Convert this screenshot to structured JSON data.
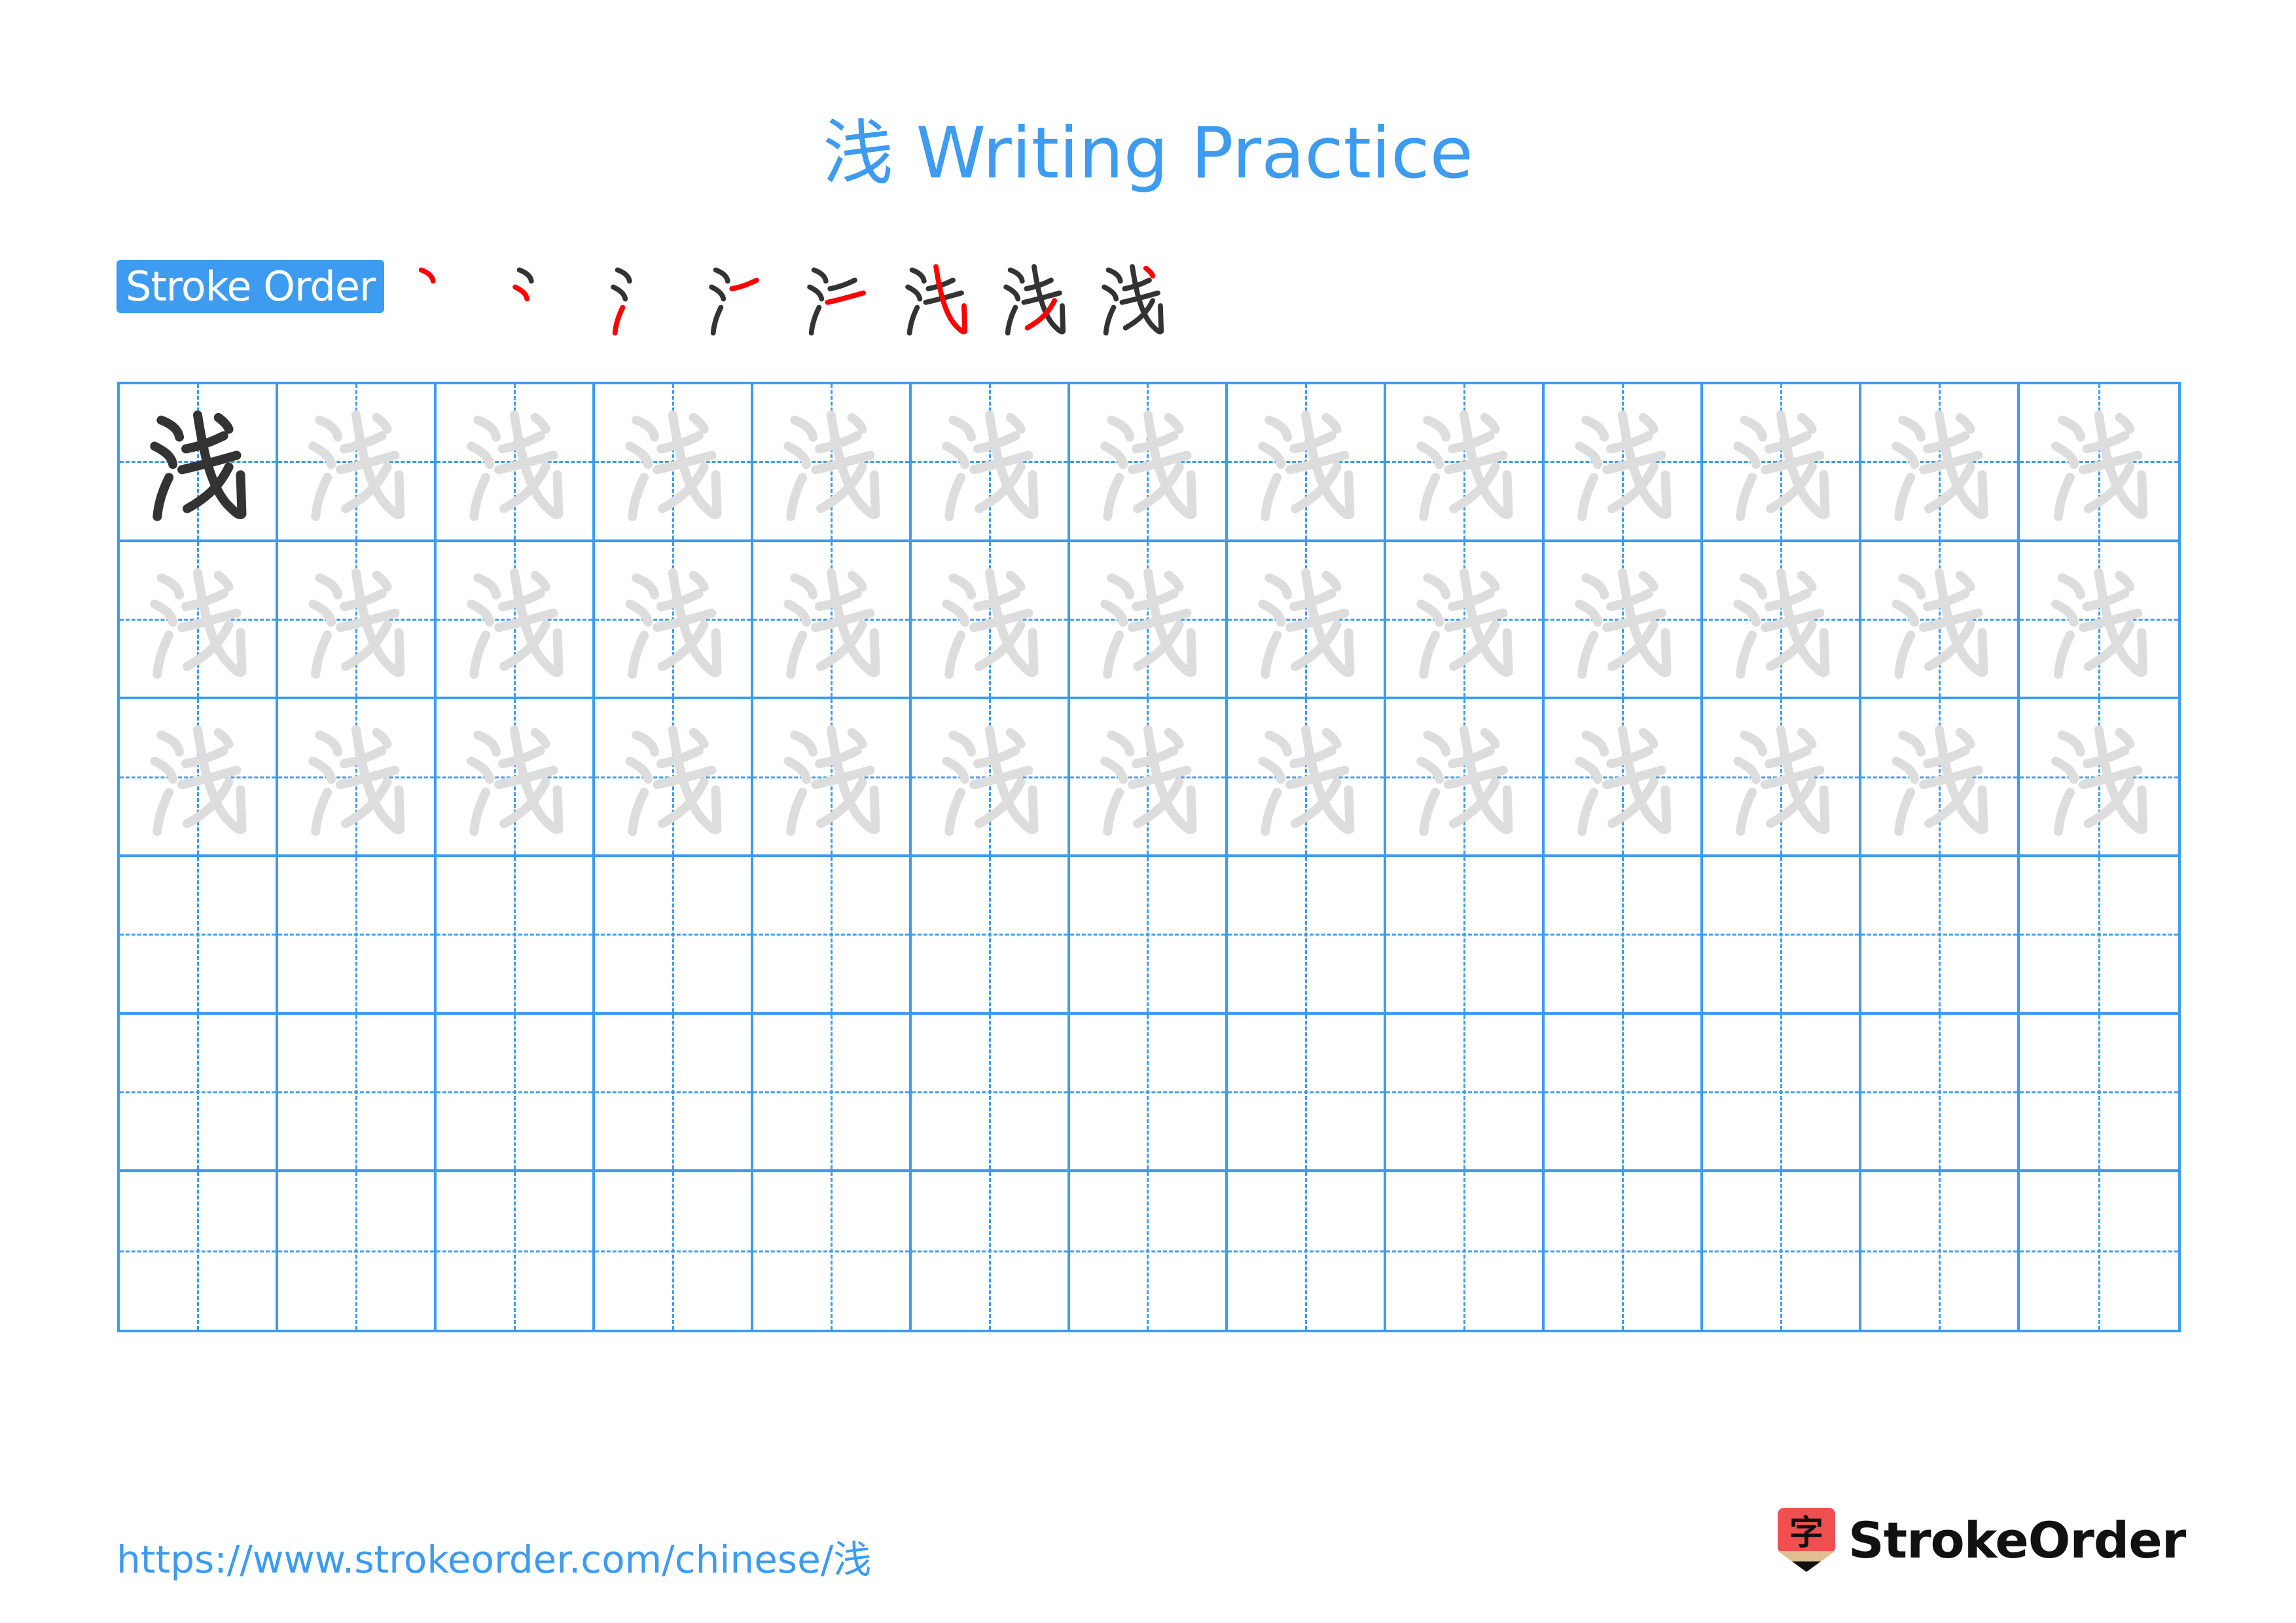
{
  "title": "浅 Writing Practice",
  "character": "浅",
  "stroke_order": {
    "label": "Stroke Order",
    "total_strokes": 8,
    "steps": [
      1,
      2,
      3,
      4,
      5,
      6,
      7,
      8
    ]
  },
  "grid": {
    "columns": 13,
    "rows": 6,
    "model_cells": 1,
    "trace_rows": 3,
    "empty_rows": 3
  },
  "colors": {
    "accent": "#3d9bf0",
    "model_ink": "#333333",
    "trace_ink": "#dddddd",
    "current_stroke": "#ff0000",
    "logo_red": "#ef4f4f",
    "logo_tan": "#e0bf93"
  },
  "footer": {
    "url": "https://www.strokeorder.com/chinese/浅",
    "brand": "StrokeOrder",
    "logo_glyph": "字"
  }
}
